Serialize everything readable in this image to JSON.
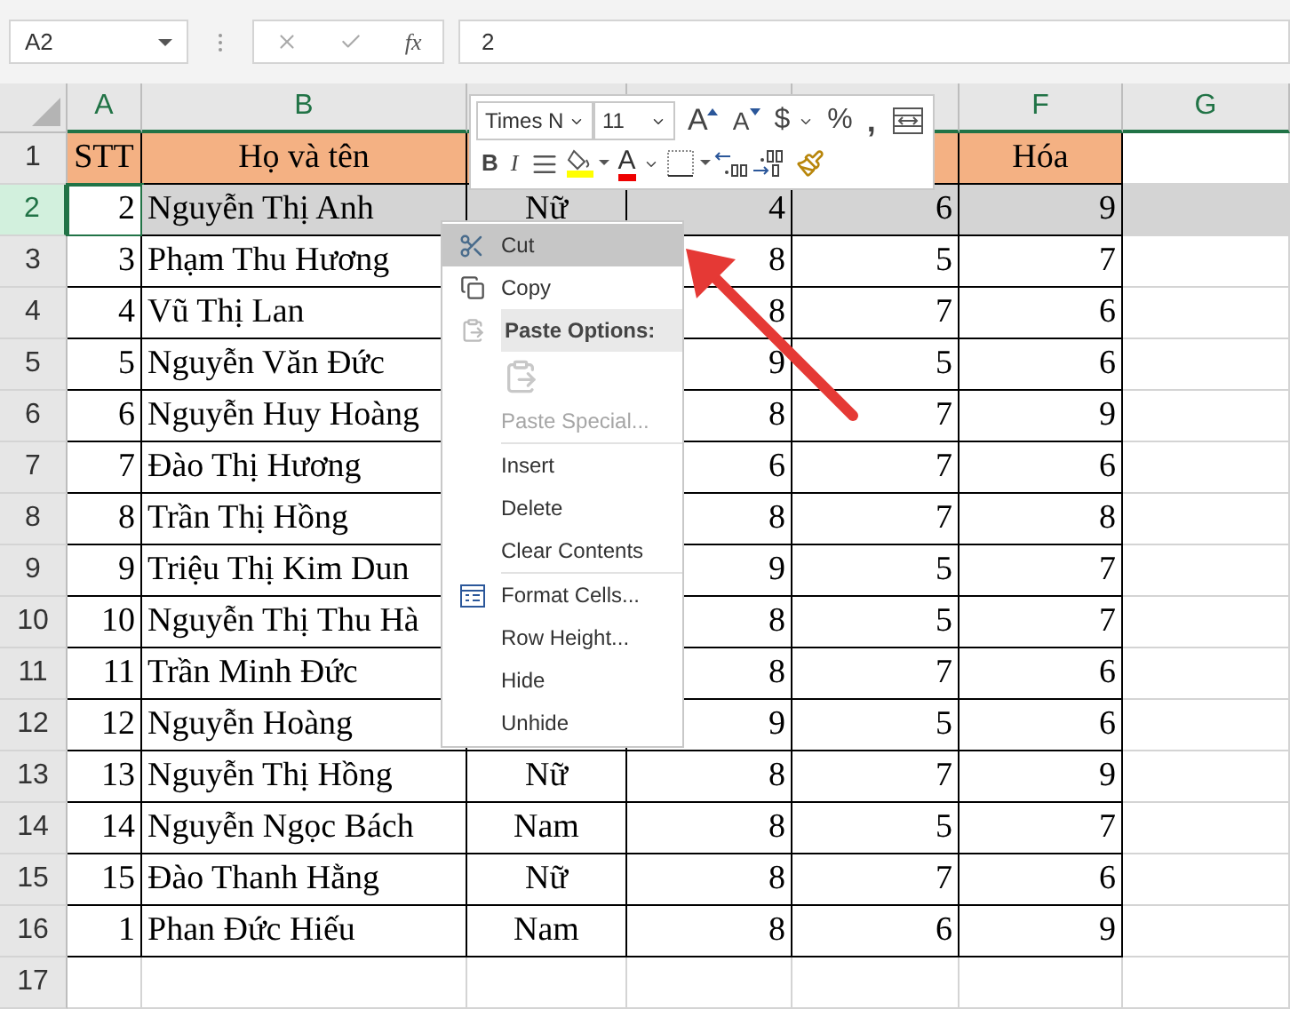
{
  "formula_bar": {
    "name_box": "A2",
    "fx": "fx",
    "value": "2"
  },
  "columns": [
    {
      "label": "A"
    },
    {
      "label": "B"
    },
    {},
    {},
    {},
    {
      "label": "F"
    },
    {
      "label": "G"
    }
  ],
  "rows": [
    {
      "number": "1",
      "kind": "header",
      "selected": false,
      "a": "STT",
      "b": "Họ và tên",
      "f": "Hóa"
    },
    {
      "number": "2",
      "kind": "data",
      "selected": true,
      "a": "2",
      "b": "Nguyễn Thị Anh",
      "c": "Nữ",
      "d": "4",
      "e": "6",
      "f": "9"
    },
    {
      "number": "3",
      "kind": "data",
      "selected": false,
      "a": "3",
      "b": "Phạm Thu Hương",
      "d": "8",
      "e": "5",
      "f": "7"
    },
    {
      "number": "4",
      "kind": "data",
      "selected": false,
      "a": "4",
      "b": "Vũ Thị Lan",
      "d": "8",
      "e": "7",
      "f": "6"
    },
    {
      "number": "5",
      "kind": "data",
      "selected": false,
      "a": "5",
      "b": "Nguyễn Văn Đức",
      "d": "9",
      "e": "5",
      "f": "6"
    },
    {
      "number": "6",
      "kind": "data",
      "selected": false,
      "a": "6",
      "b": "Nguyễn Huy Hoàng",
      "d": "8",
      "e": "7",
      "f": "9"
    },
    {
      "number": "7",
      "kind": "data",
      "selected": false,
      "a": "7",
      "b": "Đào Thị Hương",
      "d": "6",
      "e": "7",
      "f": "6"
    },
    {
      "number": "8",
      "kind": "data",
      "selected": false,
      "a": "8",
      "b": "Trần Thị Hồng",
      "d": "8",
      "e": "7",
      "f": "8"
    },
    {
      "number": "9",
      "kind": "data",
      "selected": false,
      "a": "9",
      "b": "Triệu Thị Kim Dun",
      "d": "9",
      "e": "5",
      "f": "7"
    },
    {
      "number": "10",
      "kind": "data",
      "selected": false,
      "a": "10",
      "b": "Nguyễn Thị Thu Hà",
      "d": "8",
      "e": "5",
      "f": "7"
    },
    {
      "number": "11",
      "kind": "data",
      "selected": false,
      "a": "11",
      "b": "Trần Minh Đức",
      "d": "8",
      "e": "7",
      "f": "6"
    },
    {
      "number": "12",
      "kind": "data",
      "selected": false,
      "a": "12",
      "b": "Nguyễn Hoàng",
      "d": "9",
      "e": "5",
      "f": "6"
    },
    {
      "number": "13",
      "kind": "data",
      "selected": false,
      "a": "13",
      "b": "Nguyễn Thị Hồng",
      "c": "Nữ",
      "d": "8",
      "e": "7",
      "f": "9"
    },
    {
      "number": "14",
      "kind": "data",
      "selected": false,
      "a": "14",
      "b": "Nguyễn Ngọc Bách",
      "c": "Nam",
      "d": "8",
      "e": "5",
      "f": "7"
    },
    {
      "number": "15",
      "kind": "data",
      "selected": false,
      "a": "15",
      "b": "Đào Thanh Hằng",
      "c": "Nữ",
      "d": "8",
      "e": "7",
      "f": "6"
    },
    {
      "number": "16",
      "kind": "data",
      "selected": false,
      "a": "1",
      "b": "Phan Đức Hiếu",
      "c": "Nam",
      "d": "8",
      "e": "6",
      "f": "9"
    },
    {
      "number": "17",
      "kind": "empty",
      "selected": false
    }
  ],
  "mini_toolbar": {
    "font": "Times N",
    "size": "11",
    "row1": [
      {
        "kind": "grow",
        "label": "A"
      },
      {
        "kind": "shrink",
        "label": "A"
      },
      {
        "kind": "currency",
        "label": "$"
      },
      {
        "kind": "percent",
        "label": "%"
      },
      {
        "kind": "comma",
        "label": ","
      },
      {
        "kind": "wrap"
      }
    ],
    "row2": [
      {
        "kind": "bold",
        "label": "B"
      },
      {
        "kind": "italic",
        "label": "I"
      },
      {
        "kind": "align"
      },
      {
        "kind": "fill"
      },
      {
        "kind": "fontcolor",
        "label": "A"
      },
      {
        "kind": "borders"
      },
      {
        "kind": "inc_decimal"
      },
      {
        "kind": "dec_decimal"
      },
      {
        "kind": "painter"
      }
    ]
  },
  "context_menu": {
    "groups": [
      [
        {
          "kind": "cut",
          "label": "Cut",
          "selected": true,
          "disabled": false
        },
        {
          "kind": "copy",
          "label": "Copy",
          "selected": false,
          "disabled": false
        },
        {
          "kind": "heading",
          "label": "Paste Options:",
          "selected": false,
          "disabled": false
        },
        {
          "kind": "paste",
          "selected": false,
          "disabled": true
        },
        {
          "kind": "plain",
          "label": "Paste Special...",
          "selected": false,
          "disabled": true
        }
      ],
      [
        {
          "kind": "plain",
          "label": "Insert",
          "selected": false,
          "disabled": false
        },
        {
          "kind": "plain",
          "label": "Delete",
          "selected": false,
          "disabled": false
        },
        {
          "kind": "plain",
          "label": "Clear Contents",
          "selected": false,
          "disabled": false
        }
      ],
      [
        {
          "kind": "format",
          "label": "Format Cells...",
          "selected": false,
          "disabled": false
        },
        {
          "kind": "plain",
          "label": "Row Height...",
          "selected": false,
          "disabled": false
        },
        {
          "kind": "plain",
          "label": "Hide",
          "selected": false,
          "disabled": false
        },
        {
          "kind": "plain",
          "label": "Unhide",
          "selected": false,
          "disabled": false
        }
      ]
    ]
  }
}
